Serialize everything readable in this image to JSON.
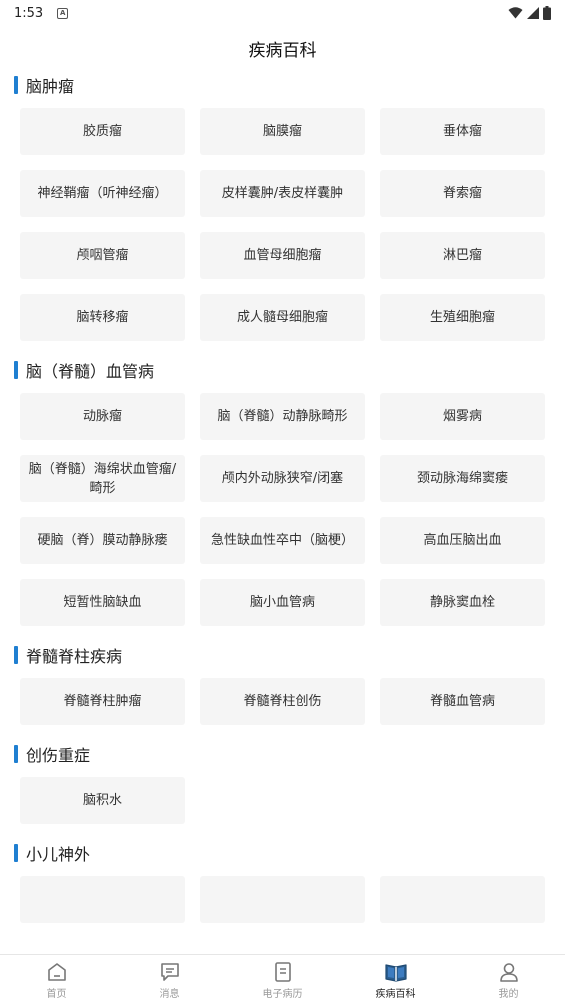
{
  "status_bar": {
    "time": "1:53",
    "notification_glyph": "A"
  },
  "header": {
    "title": "疾病百科"
  },
  "sections": [
    {
      "title": "脑肿瘤",
      "items": [
        "胶质瘤",
        "脑膜瘤",
        "垂体瘤",
        "神经鞘瘤（听神经瘤）",
        "皮样囊肿/表皮样囊肿",
        "脊索瘤",
        "颅咽管瘤",
        "血管母细胞瘤",
        "淋巴瘤",
        "脑转移瘤",
        "成人髓母细胞瘤",
        "生殖细胞瘤"
      ]
    },
    {
      "title": "脑（脊髓）血管病",
      "items": [
        "动脉瘤",
        "脑（脊髓）动静脉畸形",
        "烟雾病",
        "脑（脊髓）海绵状血管瘤/畸形",
        "颅内外动脉狭窄/闭塞",
        "颈动脉海绵窦瘘",
        "硬脑（脊）膜动静脉瘘",
        "急性缺血性卒中（脑梗）",
        "高血压脑出血",
        "短暂性脑缺血",
        "脑小血管病",
        "静脉窦血栓"
      ]
    },
    {
      "title": "脊髓脊柱疾病",
      "items": [
        "脊髓脊柱肿瘤",
        "脊髓脊柱创伤",
        "脊髓血管病"
      ]
    },
    {
      "title": "创伤重症",
      "items": [
        "脑积水"
      ]
    },
    {
      "title": "小儿神外",
      "items": [
        "",
        "",
        ""
      ]
    }
  ],
  "tab_bar": {
    "active_index": 3,
    "tabs": [
      {
        "label": "首页",
        "icon": "home-icon"
      },
      {
        "label": "消息",
        "icon": "message-icon"
      },
      {
        "label": "电子病历",
        "icon": "document-icon"
      },
      {
        "label": "疾病百科",
        "icon": "book-icon"
      },
      {
        "label": "我的",
        "icon": "user-icon"
      }
    ]
  },
  "colors": {
    "accent": "#1f7fd1",
    "chip_bg": "#f5f5f5"
  }
}
